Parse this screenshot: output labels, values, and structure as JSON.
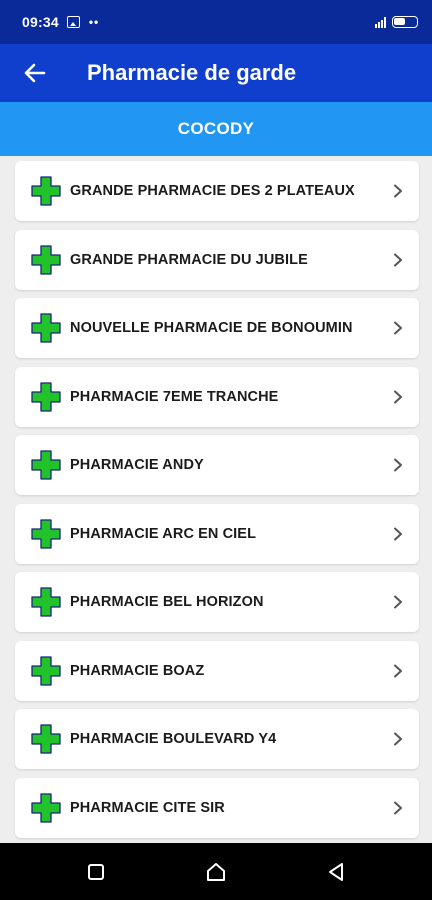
{
  "status_bar": {
    "time": "09:34",
    "dots": "••",
    "icons": [
      "image-icon",
      "signal-icon",
      "battery-icon"
    ]
  },
  "app_bar": {
    "title": "Pharmacie de garde",
    "back_icon": "arrow-back-icon"
  },
  "district": {
    "label": "COCODY"
  },
  "pharmacies": [
    "GRANDE PHARMACIE DES 2 PLATEAUX",
    "GRANDE PHARMACIE DU JUBILE",
    "NOUVELLE PHARMACIE DE BONOUMIN",
    "PHARMACIE 7EME TRANCHE",
    "PHARMACIE ANDY",
    "PHARMACIE ARC EN CIEL",
    "PHARMACIE BEL HORIZON",
    "PHARMACIE BOAZ",
    "PHARMACIE BOULEVARD Y4",
    "PHARMACIE CITE SIR"
  ],
  "colors": {
    "status_bar": "#0a2a9a",
    "app_bar": "#0f3fcc",
    "district_header": "#2196f3",
    "cross_fill": "#22c32a",
    "cross_outline": "#1a237e",
    "background": "#eeeeee"
  },
  "nav_bar": {
    "buttons": [
      "recent-apps-icon",
      "home-icon",
      "back-icon"
    ]
  }
}
